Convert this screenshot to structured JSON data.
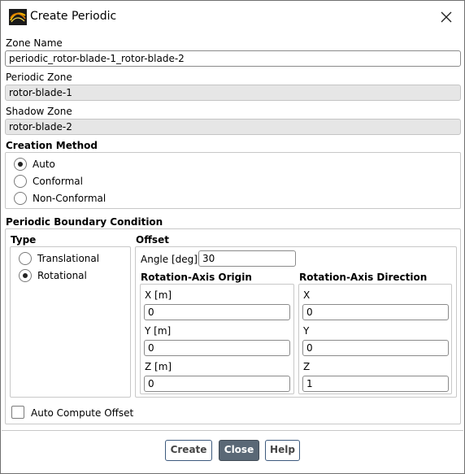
{
  "window": {
    "title": "Create Periodic",
    "close_icon": "close-icon"
  },
  "zone_name": {
    "label": "Zone Name",
    "value": "periodic_rotor-blade-1_rotor-blade-2"
  },
  "periodic_zone": {
    "label": "Periodic Zone",
    "value": "rotor-blade-1"
  },
  "shadow_zone": {
    "label": "Shadow Zone",
    "value": "rotor-blade-2"
  },
  "creation_method": {
    "label": "Creation Method",
    "options": [
      {
        "label": "Auto",
        "selected": true
      },
      {
        "label": "Conformal",
        "selected": false
      },
      {
        "label": "Non-Conformal",
        "selected": false
      }
    ]
  },
  "pbc": {
    "label": "Periodic Boundary Condition",
    "type": {
      "label": "Type",
      "options": [
        {
          "label": "Translational",
          "selected": false
        },
        {
          "label": "Rotational",
          "selected": true
        }
      ]
    },
    "offset": {
      "label": "Offset",
      "angle_label": "Angle [deg]",
      "angle_value": "30",
      "origin": {
        "label": "Rotation-Axis Origin",
        "x_label": "X [m]",
        "x_value": "0",
        "y_label": "Y [m]",
        "y_value": "0",
        "z_label": "Z [m]",
        "z_value": "0"
      },
      "direction": {
        "label": "Rotation-Axis Direction",
        "x_label": "X",
        "x_value": "0",
        "y_label": "Y",
        "y_value": "0",
        "z_label": "Z",
        "z_value": "1"
      }
    },
    "auto_compute": {
      "label": "Auto Compute Offset",
      "checked": false
    }
  },
  "buttons": {
    "create": "Create",
    "close": "Close",
    "help": "Help"
  }
}
